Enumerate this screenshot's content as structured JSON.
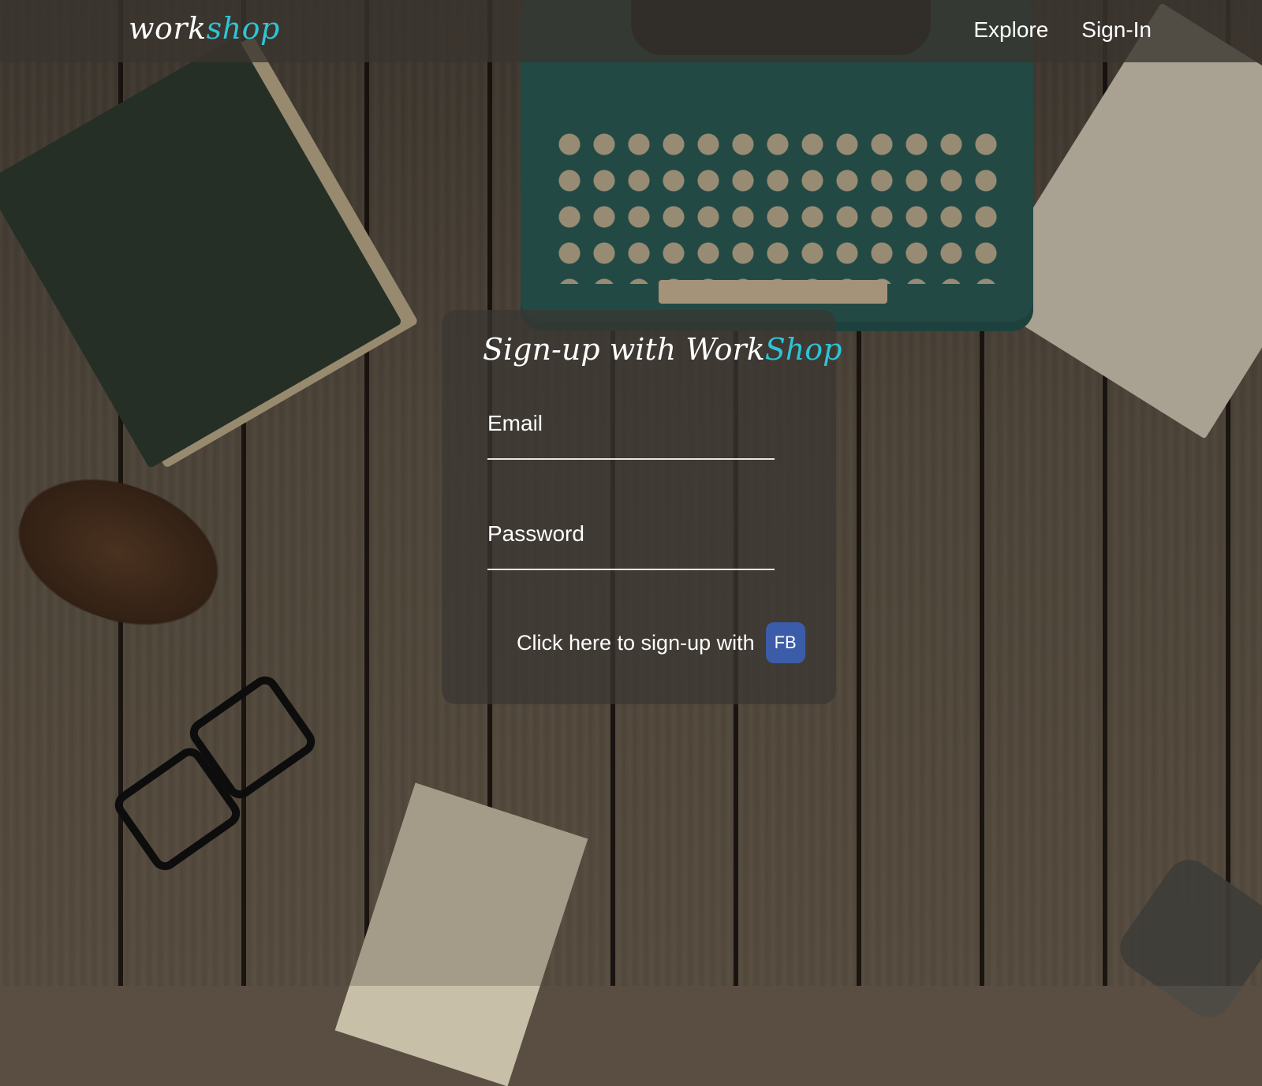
{
  "header": {
    "logo_part1": "work",
    "logo_part2": "shop",
    "nav": [
      {
        "label": "Explore"
      },
      {
        "label": "Sign-In"
      }
    ]
  },
  "signup": {
    "title_prefix": "Sign-up with Work",
    "title_accent": "Shop",
    "email_placeholder": "Email",
    "password_placeholder": "Password",
    "fb_prompt": "Click here to sign-up with",
    "fb_button_label": "FB"
  },
  "colors": {
    "accent": "#2ec4d6",
    "facebook": "#3b5ca8",
    "navbar_bg": "rgba(58,52,46,0.78)"
  }
}
